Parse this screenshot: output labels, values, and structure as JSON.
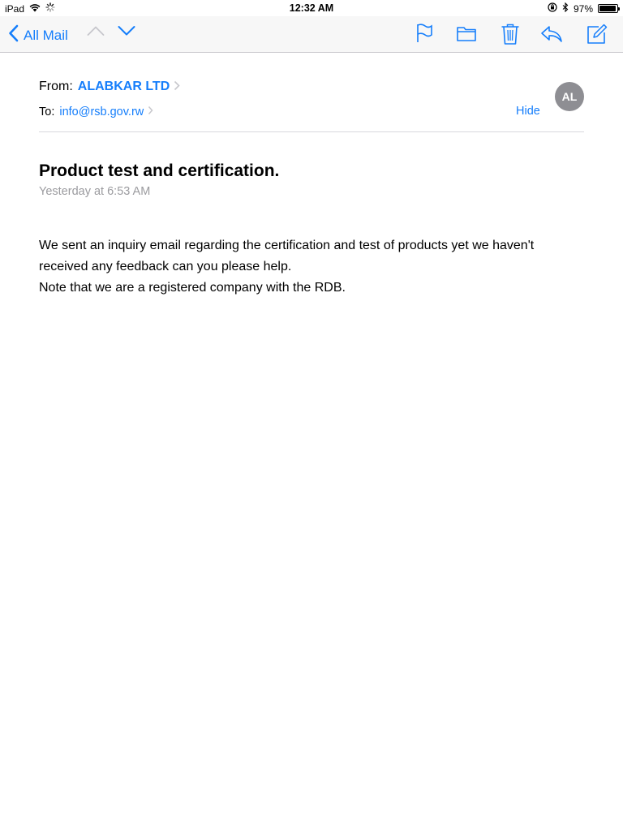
{
  "status_bar": {
    "device": "iPad",
    "time": "12:32 AM",
    "battery_percent": "97%",
    "battery_level": 0.97,
    "icons": [
      "wifi-icon",
      "activity-spinner-icon",
      "orientation-lock-icon",
      "bluetooth-icon",
      "battery-icon"
    ]
  },
  "toolbar": {
    "back_label": "All Mail",
    "icons": [
      "chevron-left-icon",
      "chevron-up-icon",
      "chevron-down-icon",
      "flag-icon",
      "folder-icon",
      "trash-icon",
      "reply-icon",
      "compose-icon"
    ],
    "accent_color": "#157efb"
  },
  "message": {
    "from_label": "From:",
    "from_name": "ALABKAR LTD",
    "to_label": "To:",
    "to_address": "info@rsb.gov.rw",
    "hide_label": "Hide",
    "avatar_initials": "AL",
    "subject": "Product test and certification.",
    "date": "Yesterday at 6:53 AM",
    "body_lines": [
      "We sent an inquiry email regarding the certification and test of products yet we haven't",
      "received any feedback can you please help.",
      "Note that we are a registered company with the RDB."
    ]
  }
}
